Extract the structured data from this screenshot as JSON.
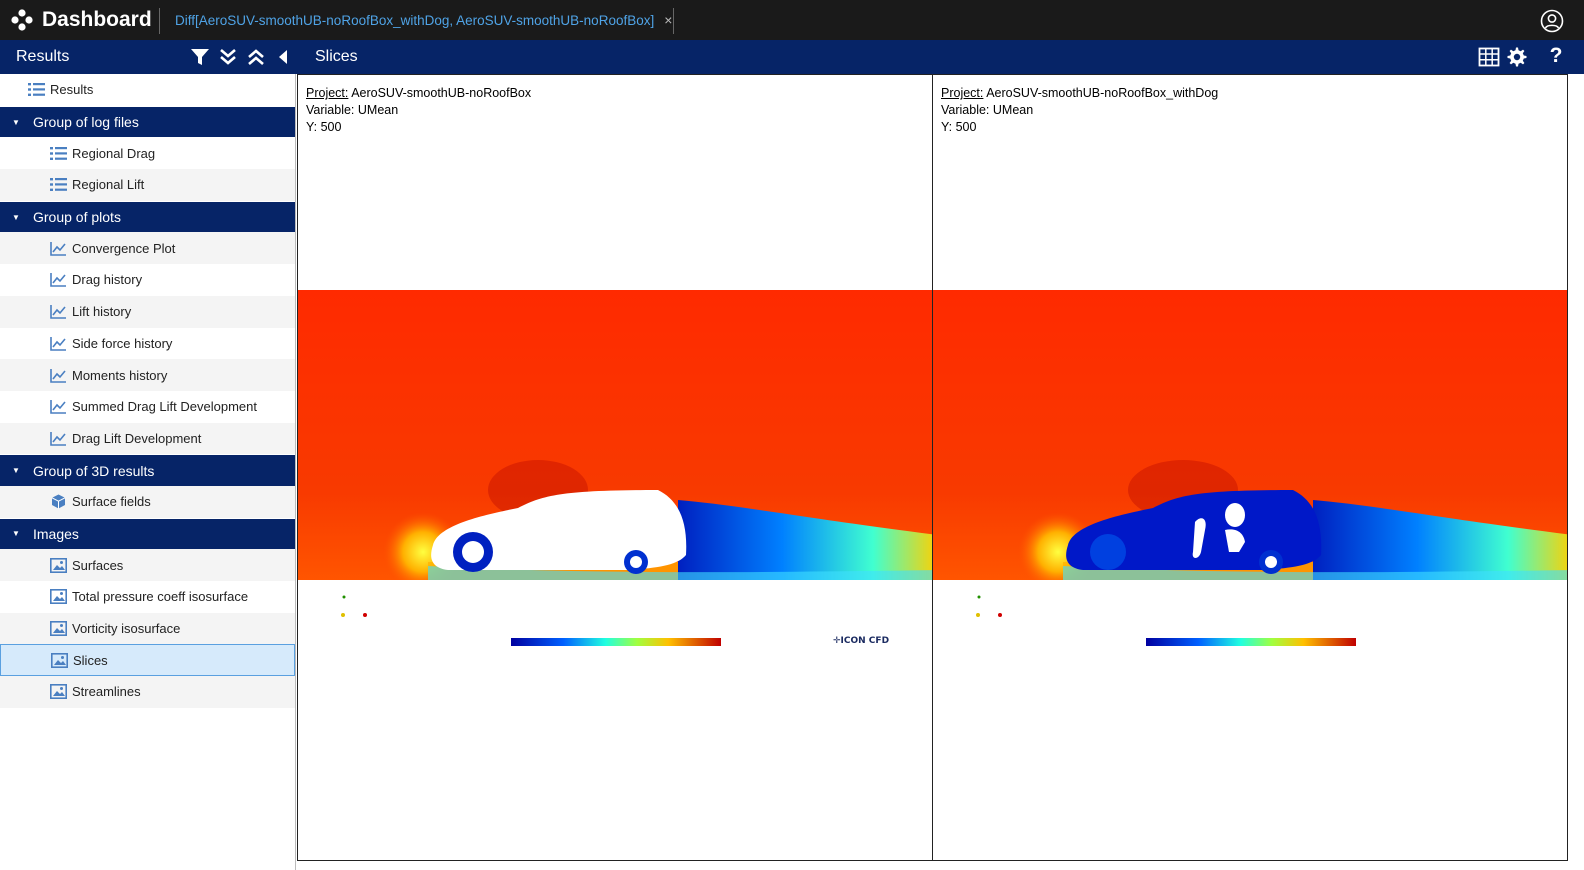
{
  "app": {
    "title": "Dashboard",
    "tab_label": "Diff[AeroSUV-smoothUB-noRoofBox_withDog, AeroSUV-smoothUB-noRoofBox]",
    "tab_close": "×"
  },
  "toolbar": {
    "results_title": "Results",
    "slices_title": "Slices",
    "help": "?"
  },
  "sidebar": {
    "root_label": "Results",
    "groups": [
      {
        "label": "Group of log files",
        "items": [
          "Regional Drag",
          "Regional Lift"
        ]
      },
      {
        "label": "Group of plots",
        "items": [
          "Convergence Plot",
          "Drag history",
          "Lift history",
          "Side force history",
          "Moments history",
          "Summed Drag Lift Development",
          "Drag Lift Development"
        ]
      },
      {
        "label": "Group of 3D results",
        "items": [
          "Surface fields"
        ]
      },
      {
        "label": "Images",
        "items": [
          "Surfaces",
          "Total pressure coeff isosurface",
          "Vorticity isosurface",
          "Slices",
          "Streamlines"
        ]
      }
    ],
    "selected": "Slices"
  },
  "panels": [
    {
      "project_label": "Project:",
      "project": "AeroSUV-smoothUB-noRoofBox",
      "variable": "Variable: UMean",
      "y": "Y: 500"
    },
    {
      "project_label": "Project:",
      "project": "AeroSUV-smoothUB-noRoofBox_withDog",
      "variable": "Variable: UMean",
      "y": "Y: 500"
    }
  ],
  "colors": {
    "topbar": "#1a1a1a",
    "navbar": "#062467",
    "tab_text": "#4fa3e6",
    "selected_bg": "#d6eafb"
  }
}
